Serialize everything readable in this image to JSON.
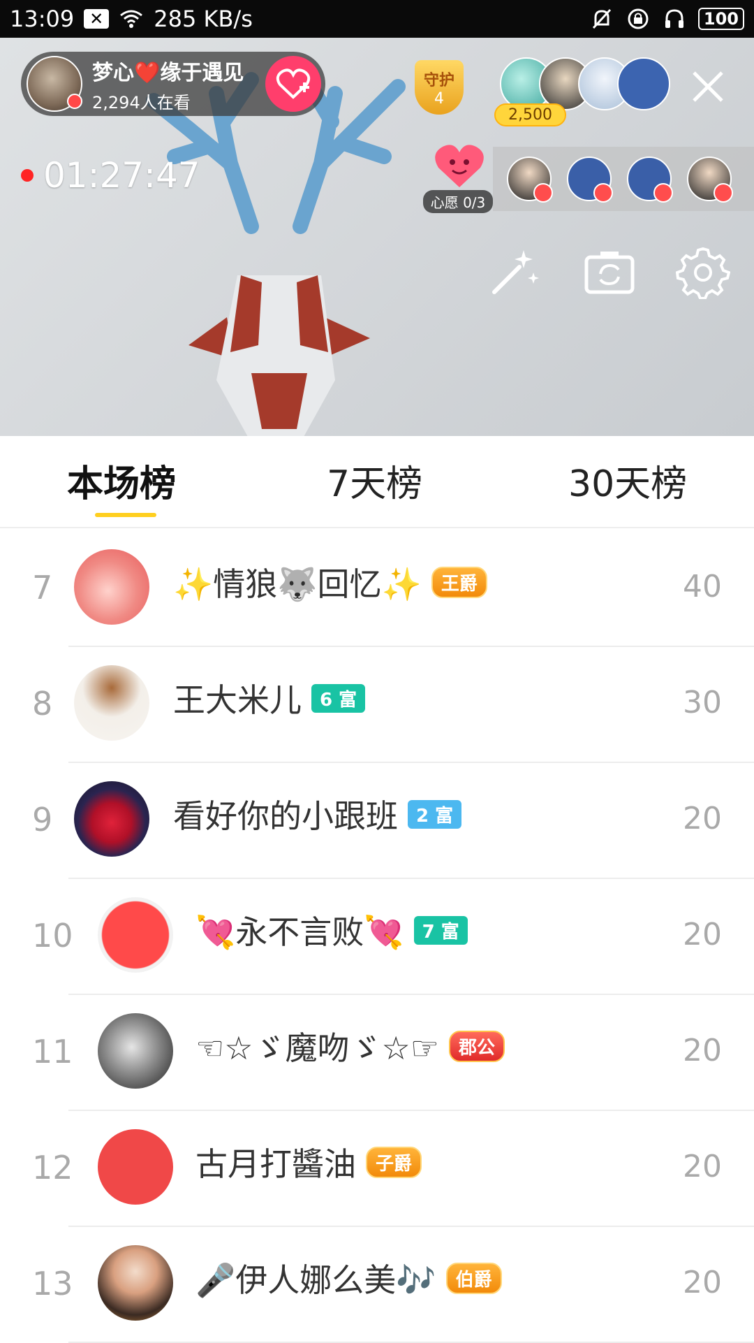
{
  "status_bar": {
    "time": "13:09",
    "speed": "285 KB/s",
    "battery": "100"
  },
  "live": {
    "host_name": "梦心❤️缘于遇见",
    "viewers": "2,294人在看",
    "guard_label": "守护",
    "guard_count": "4",
    "fan_score": "2,500",
    "timer": "01:27:47",
    "wish_label": "心愿 0/3"
  },
  "tabs": [
    {
      "label": "本场榜",
      "active": true
    },
    {
      "label": "7天榜",
      "active": false
    },
    {
      "label": "30天榜",
      "active": false
    }
  ],
  "ranking": [
    {
      "rank": "7",
      "name": "✨情狼🐺回忆✨",
      "tag": "王爵",
      "tag_style": "noble",
      "score": "40"
    },
    {
      "rank": "8",
      "name": "王大米儿",
      "tag": "6 富",
      "tag_style": "teal",
      "score": "30"
    },
    {
      "rank": "9",
      "name": "看好你的小跟班",
      "tag": "2 富",
      "tag_style": "blue",
      "score": "20"
    },
    {
      "rank": "10",
      "name": "💘永不言败💘",
      "tag": "7 富",
      "tag_style": "teal",
      "score": "20"
    },
    {
      "rank": "11",
      "name": "☜☆ゞ魔吻ゞ☆☞",
      "tag": "郡公",
      "tag_style": "red",
      "score": "20"
    },
    {
      "rank": "12",
      "name": "古月打醬油",
      "tag": "子爵",
      "tag_style": "noble",
      "score": "20"
    },
    {
      "rank": "13",
      "name": "🎤伊人娜么美🎶",
      "tag": "伯爵",
      "tag_style": "noble",
      "score": "20"
    }
  ],
  "colors": {
    "accent_yellow": "#ffcf1f",
    "follow_pink": "#ff3e6c",
    "teal_tag": "#19c3a4",
    "blue_tag": "#4cb8f0"
  }
}
